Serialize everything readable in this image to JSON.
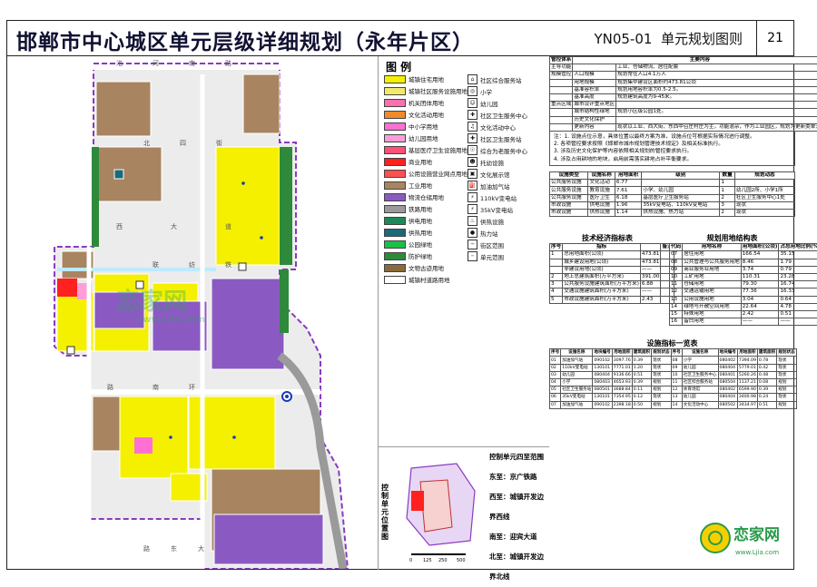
{
  "header": {
    "title": "邯郸市中心城区单元层级详细规划（永年片区）",
    "code": "YN05-01",
    "map_name": "单元规划图则",
    "page_number": "21"
  },
  "map": {
    "road_labels": [
      "洺",
      "河",
      "南",
      "路",
      "北",
      "四",
      "街",
      "西",
      "大",
      "道",
      "联",
      "纺",
      "铁",
      "路",
      "南",
      "环",
      "路",
      "东",
      "大",
      "街"
    ]
  },
  "legend": {
    "title": "图  例",
    "left_items": [
      {
        "label": "城镇住宅用地",
        "color": "#f5f000"
      },
      {
        "label": "城镇社区服务设施用地",
        "color": "#f2e96a"
      },
      {
        "label": "机关团体用地",
        "color": "#ff6fb0"
      },
      {
        "label": "文化活动用地",
        "color": "#f08a2a"
      },
      {
        "label": "中小学用地",
        "color": "#ff70d2"
      },
      {
        "label": "幼儿园用地",
        "color": "#ff9dd8"
      },
      {
        "label": "基层医疗卫生设施用地",
        "color": "#ff5078"
      },
      {
        "label": "商业用地",
        "color": "#ff2020"
      },
      {
        "label": "公用设施营业网点用地",
        "color": "#ff5050"
      },
      {
        "label": "工业用地",
        "color": "#a88460"
      },
      {
        "label": "物流仓储用地",
        "color": "#8a5ac2"
      },
      {
        "label": "铁路用地",
        "color": "#9a9a9a"
      },
      {
        "label": "供电用地",
        "color": "#1a8a5a"
      },
      {
        "label": "供热用地",
        "color": "#1a6a7a"
      },
      {
        "label": "公园绿地",
        "color": "#18c048"
      },
      {
        "label": "防护绿地",
        "color": "#2e8a3a"
      },
      {
        "label": "文物古迹用地",
        "color": "#8a6a3a"
      },
      {
        "label": "城镇村道路用地",
        "color": "#ffffff"
      }
    ],
    "right_items": [
      {
        "label": "社区综合服务站",
        "icon": "community-service-icon"
      },
      {
        "label": "小学",
        "icon": "primary-school-icon"
      },
      {
        "label": "幼儿园",
        "icon": "kindergarten-icon"
      },
      {
        "label": "社区卫生服务中心",
        "icon": "health-center-icon"
      },
      {
        "label": "文化活动中心",
        "icon": "culture-center-icon"
      },
      {
        "label": "社区卫生服务站",
        "icon": "health-station-icon"
      },
      {
        "label": "综合为老服务中心",
        "icon": "elderly-service-icon"
      },
      {
        "label": "托幼设施",
        "icon": "childcare-icon"
      },
      {
        "label": "文化展示馆",
        "icon": "exhibition-icon"
      },
      {
        "label": "加油加气站",
        "icon": "gas-station-icon"
      },
      {
        "label": "110kV变电站",
        "icon": "substation-110kv-icon"
      },
      {
        "label": "35kV变电站",
        "icon": "substation-35kv-icon"
      },
      {
        "label": "供热设施",
        "icon": "heating-facility-icon"
      },
      {
        "label": "热力站",
        "icon": "heat-station-icon"
      },
      {
        "label": "街区范围",
        "icon": "block-boundary-icon"
      },
      {
        "label": "单元范围",
        "icon": "unit-boundary-icon"
      }
    ]
  },
  "control": {
    "title": "管控体系",
    "col2": "主要内容",
    "rows": [
      [
        "主导功能",
        "",
        "工业、仓储物流、居住配套"
      ],
      [
        "规模管控",
        "人口规模",
        "规划常住人口4.1万人"
      ],
      [
        "",
        "用地规模",
        "规划集中建设区面积约473.81公顷"
      ],
      [
        "",
        "基准容积率",
        "规划用地容积率为0.5-2.5。"
      ],
      [
        "",
        "基准高度",
        "规划建筑高度为9-45米。"
      ],
      [
        "重点区域",
        "城市设计重点地区",
        ""
      ],
      [
        "",
        "城市结构性绿地",
        "规划小区级公园1处。"
      ],
      [
        "",
        "历史文化保护",
        ""
      ],
      [
        "",
        "更新内容",
        "现状以工业、西大街、东西中召庄村庄为主，功能混杂，作为工业园区，规划为更新类单元。"
      ]
    ],
    "notes": [
      "注：1. 设施点位示意，具体位置以最终方案为准，设施点位可根据实际情况进行调整。",
      "2. 各项管控要求按照《邯郸市城市规划管理技术规定》及相关标准执行。",
      "3. 涉及历史文化保护等内容依照相关规划的管控要求执行。",
      "4. 涉及占用耕地的地块，启用前需落实耕地占补平衡要求。"
    ]
  },
  "facilities_small": {
    "headers": [
      "设施类型",
      "设施名称",
      "用地面积",
      "级别",
      "数量",
      "规划动态"
    ],
    "rows": [
      [
        "公共服务设施",
        "文化活动",
        "6.77",
        "",
        "1",
        ""
      ],
      [
        "公共服务设施",
        "教育设施",
        "7.61",
        "小学、幼儿园",
        "1",
        "幼儿园2所、小学1所"
      ],
      [
        "公共服务设施",
        "医疗卫生",
        "6.18",
        "基层医疗卫生服务站",
        "2",
        "社区卫生服务中心1处"
      ],
      [
        "市政设施",
        "供电设施",
        "1.96",
        "35kV变电站、110kV变电站",
        "3",
        "现状"
      ],
      [
        "市政设施",
        "供热设施",
        "1.14",
        "供热设施、热力站",
        "2",
        "现状"
      ]
    ]
  },
  "tech_indicators": {
    "title": "技术经济指标表",
    "headers": [
      "序号",
      "指标",
      "",
      "备注"
    ],
    "rows": [
      [
        "1",
        "总用地面积(公顷)",
        "473.81",
        ""
      ],
      [
        "",
        "城乡建设用地(公顷)",
        "473.81",
        ""
      ],
      [
        "",
        "非建设用地(公顷)",
        "——",
        ""
      ],
      [
        "2",
        "地上总建筑面积(万平方米)",
        "391.00",
        ""
      ],
      [
        "3",
        "公共服务设施建筑面积(万平方米)",
        "6.88",
        ""
      ],
      [
        "4",
        "交通设施建筑面积(万平方米)",
        "——",
        ""
      ],
      [
        "5",
        "市政设施建筑面积(万平方米)",
        "2.43",
        ""
      ]
    ]
  },
  "landuse_structure": {
    "title": "规划用地结构表",
    "headers": [
      "代码",
      "用地名称",
      "用地面积(公顷)",
      "占总用地比例(%)"
    ],
    "rows": [
      [
        "07",
        "居住用地",
        "166.54",
        "35.15"
      ],
      [
        "08",
        "公共管理与公共服务用地",
        "8.46",
        "1.79"
      ],
      [
        "09",
        "商业服务业用地",
        "3.74",
        "0.79"
      ],
      [
        "10",
        "工矿用地",
        "110.31",
        "23.28"
      ],
      [
        "11",
        "仓储用地",
        "79.30",
        "16.74"
      ],
      [
        "12",
        "交通运输用地",
        "77.36",
        "16.33"
      ],
      [
        "13",
        "公用设施用地",
        "3.04",
        "0.64"
      ],
      [
        "14",
        "绿地与开敞空间用地",
        "22.64",
        "4.78"
      ],
      [
        "15",
        "特殊用地",
        "2.42",
        "0.51"
      ],
      [
        "16",
        "留白用地",
        "——",
        "——"
      ]
    ]
  },
  "facility_list": {
    "title": "设施指标一览表",
    "headers": [
      "序号",
      "设施名称",
      "地块编号",
      "用地面积",
      "建筑面积",
      "规划状态",
      "序号",
      "设施名称",
      "地块编号",
      "用地面积",
      "建筑面积",
      "规划状态"
    ],
    "rows": [
      [
        "01",
        "加油加气站",
        "090102",
        "3097.76",
        "0.39",
        "现状",
        "08",
        "小学",
        "080402",
        "7394.09",
        "0.78",
        "现状"
      ],
      [
        "02",
        "110kV变电站",
        "130101",
        "7771.01",
        "1.20",
        "现状",
        "09",
        "幼儿园",
        "080404",
        "5779.01",
        "0.42",
        "现状"
      ],
      [
        "03",
        "幼儿园",
        "080404",
        "9136.66",
        "0.51",
        "现状",
        "10",
        "社区卫生服务中心",
        "080401",
        "5260.26",
        "0.48",
        "现状"
      ],
      [
        "04",
        "小学",
        "080403",
        "4653.93",
        "0.39",
        "规划",
        "11",
        "社区综合服务站",
        "080504",
        "1137.21",
        "0.08",
        "规划"
      ],
      [
        "05",
        "社区卫生服务站",
        "080501",
        "3688.84",
        "0.11",
        "规划",
        "12",
        "体育场馆",
        "080402",
        "6599.90",
        "0.39",
        "规划"
      ],
      [
        "06",
        "35kV变电站",
        "130101",
        "7354.95",
        "0.12",
        "现状",
        "13",
        "幼儿园",
        "080404",
        "3400.98",
        "0.24",
        "现状"
      ],
      [
        "07",
        "加油加气站",
        "090102",
        "2398.18",
        "0.50",
        "规划",
        "14",
        "文化活动中心",
        "080502",
        "3434.97",
        "0.51",
        "规划"
      ]
    ]
  },
  "inset": {
    "title": "控制单元位置图",
    "scale_labels": [
      "0",
      "125",
      "250",
      "500"
    ],
    "scope_title": "控制单元四至范围",
    "scope": [
      "东至：京广铁路",
      "西至：城镇开发边界西线",
      "南至：迎宾大道",
      "北至：城镇开发边界北线"
    ]
  },
  "watermark": {
    "brand": "恋家网",
    "url": "www.Ljia.com"
  }
}
